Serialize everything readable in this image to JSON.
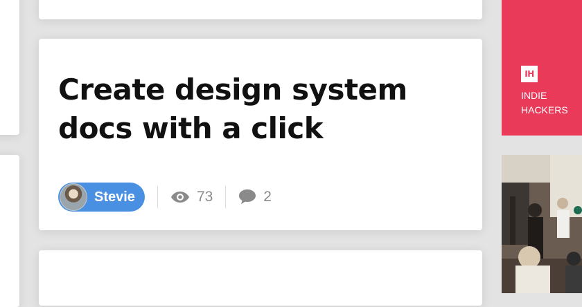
{
  "post": {
    "title": "Create design system docs with a click",
    "author": "Stevie",
    "views": "73",
    "comments": "2"
  },
  "sidebar": {
    "ad_logo": "IH",
    "ad_text": "INDIE HACKERS"
  },
  "colors": {
    "accent_blue": "#4a90e2",
    "brand_red": "#ea3a5a",
    "background": "#e3e3e3"
  },
  "icons": {
    "views": "eye-icon",
    "comments": "speech-bubble-icon"
  }
}
